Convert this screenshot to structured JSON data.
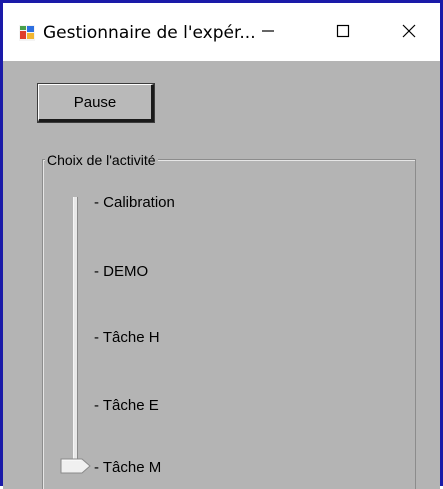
{
  "window": {
    "title": "Gestionnaire de l'expér...",
    "border_color": "#1a1aa8"
  },
  "titlebar_buttons": {
    "minimize": "minimize-icon",
    "maximize": "maximize-icon",
    "close": "close-icon"
  },
  "toolbar": {
    "pause_label": "Pause"
  },
  "activity_group": {
    "title": "Choix de l'activité",
    "options": [
      "- Calibration",
      "- DEMO",
      "- Tâche H",
      "- Tâche E",
      "- Tâche M"
    ],
    "selected_index": 4
  },
  "colors": {
    "client_background": "#b4b4b4",
    "titlebar_background": "#ffffff"
  }
}
